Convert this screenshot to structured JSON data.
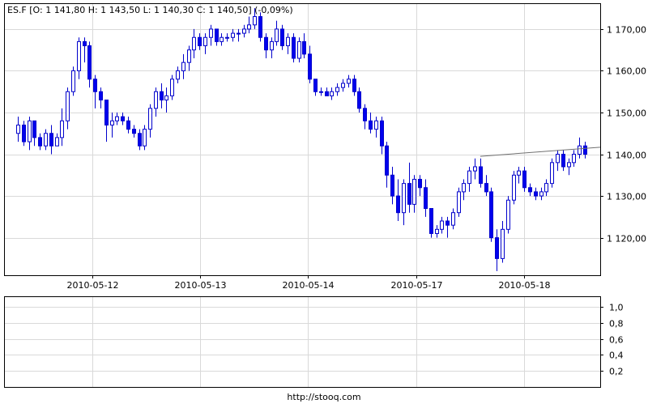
{
  "chart_data": [
    {
      "type": "candlestick",
      "title": "ES.F [O: 1 141,80  H: 1 143,50  L: 1 140,30  C: 1 140,50] (-0,09%)",
      "x_labels": [
        "2010-05-12",
        "2010-05-13",
        "2010-05-14",
        "2010-05-17",
        "2010-05-18"
      ],
      "y_tick_labels": [
        "1 120,00",
        "1 130,00",
        "1 140,00",
        "1 150,00",
        "1 160,00",
        "1 170,00"
      ],
      "y_ticks": [
        1120,
        1130,
        1140,
        1150,
        1160,
        1170
      ],
      "ylim": [
        1111,
        1176
      ],
      "grid": true,
      "colors": {
        "bullish": "#ffffff",
        "bearish": "#0000ee",
        "wick": "#0000cc",
        "grid": "#d9d9d9",
        "trendline": "#707070"
      },
      "trendline": {
        "start_index": 84,
        "start_value": 1139.5,
        "end_index": 107,
        "end_value": 1141.8
      },
      "candles": [
        [
          1145,
          1149,
          1143,
          1147
        ],
        [
          1147,
          1148,
          1142,
          1143
        ],
        [
          1143,
          1149,
          1141,
          1148
        ],
        [
          1148,
          1148,
          1142,
          1144
        ],
        [
          1144,
          1145,
          1141,
          1142
        ],
        [
          1142,
          1146,
          1141,
          1145
        ],
        [
          1145,
          1147,
          1140,
          1142
        ],
        [
          1142,
          1145,
          1142,
          1144
        ],
        [
          1144,
          1151,
          1142,
          1148
        ],
        [
          1148,
          1156,
          1146,
          1155
        ],
        [
          1155,
          1161,
          1154,
          1160
        ],
        [
          1160,
          1168,
          1158,
          1167
        ],
        [
          1167,
          1168,
          1162,
          1166
        ],
        [
          1166,
          1167,
          1156,
          1158
        ],
        [
          1158,
          1159,
          1151,
          1155
        ],
        [
          1155,
          1156,
          1151,
          1153
        ],
        [
          1153,
          1153,
          1143,
          1147
        ],
        [
          1147,
          1150,
          1144,
          1148
        ],
        [
          1148,
          1150,
          1147,
          1149
        ],
        [
          1149,
          1150,
          1147,
          1148
        ],
        [
          1148,
          1149,
          1145,
          1146
        ],
        [
          1146,
          1147,
          1144,
          1145
        ],
        [
          1145,
          1146,
          1141,
          1142
        ],
        [
          1142,
          1147,
          1141,
          1146
        ],
        [
          1146,
          1152,
          1144,
          1151
        ],
        [
          1151,
          1156,
          1149,
          1155
        ],
        [
          1155,
          1157,
          1151,
          1153
        ],
        [
          1153,
          1156,
          1150,
          1154
        ],
        [
          1154,
          1159,
          1153,
          1158
        ],
        [
          1158,
          1161,
          1157,
          1160
        ],
        [
          1160,
          1164,
          1158,
          1162
        ],
        [
          1162,
          1166,
          1160,
          1165
        ],
        [
          1165,
          1170,
          1163,
          1168
        ],
        [
          1168,
          1169,
          1165,
          1166
        ],
        [
          1166,
          1169,
          1164,
          1168
        ],
        [
          1168,
          1171,
          1166,
          1170
        ],
        [
          1170,
          1170,
          1166,
          1167
        ],
        [
          1167,
          1169,
          1166,
          1168
        ],
        [
          1168,
          1169,
          1167,
          1168
        ],
        [
          1168,
          1170,
          1167,
          1169
        ],
        [
          1169,
          1170,
          1167,
          1169
        ],
        [
          1169,
          1171,
          1168,
          1170
        ],
        [
          1170,
          1173,
          1169,
          1171
        ],
        [
          1171,
          1175,
          1170,
          1173
        ],
        [
          1173,
          1174,
          1167,
          1168
        ],
        [
          1168,
          1169,
          1163,
          1165
        ],
        [
          1165,
          1168,
          1163,
          1167
        ],
        [
          1167,
          1172,
          1166,
          1170
        ],
        [
          1170,
          1171,
          1165,
          1166
        ],
        [
          1166,
          1169,
          1164,
          1168
        ],
        [
          1168,
          1169,
          1162,
          1163
        ],
        [
          1163,
          1168,
          1162,
          1167
        ],
        [
          1167,
          1169,
          1163,
          1164
        ],
        [
          1164,
          1166,
          1157,
          1158
        ],
        [
          1158,
          1158,
          1154,
          1155
        ],
        [
          1155,
          1156,
          1154,
          1155
        ],
        [
          1155,
          1156,
          1154,
          1154
        ],
        [
          1154,
          1156,
          1153,
          1155
        ],
        [
          1155,
          1157,
          1154,
          1156
        ],
        [
          1156,
          1158,
          1155,
          1157
        ],
        [
          1157,
          1159,
          1156,
          1158
        ],
        [
          1158,
          1159,
          1154,
          1155
        ],
        [
          1155,
          1156,
          1150,
          1151
        ],
        [
          1151,
          1152,
          1146,
          1148
        ],
        [
          1148,
          1150,
          1145,
          1146
        ],
        [
          1146,
          1149,
          1144,
          1148
        ],
        [
          1148,
          1149,
          1140,
          1142
        ],
        [
          1142,
          1143,
          1132,
          1135
        ],
        [
          1135,
          1137,
          1128,
          1130
        ],
        [
          1130,
          1134,
          1124,
          1126
        ],
        [
          1126,
          1134,
          1123,
          1133
        ],
        [
          1133,
          1138,
          1126,
          1128
        ],
        [
          1128,
          1135,
          1126,
          1134
        ],
        [
          1134,
          1135,
          1130,
          1132
        ],
        [
          1132,
          1134,
          1125,
          1127
        ],
        [
          1127,
          1127,
          1120,
          1121
        ],
        [
          1121,
          1123,
          1120,
          1122
        ],
        [
          1122,
          1125,
          1121,
          1124
        ],
        [
          1124,
          1125,
          1120,
          1123
        ],
        [
          1123,
          1127,
          1122,
          1126
        ],
        [
          1126,
          1132,
          1125,
          1131
        ],
        [
          1131,
          1134,
          1129,
          1133
        ],
        [
          1133,
          1137,
          1131,
          1136
        ],
        [
          1136,
          1139,
          1134,
          1137
        ],
        [
          1137,
          1139,
          1132,
          1133
        ],
        [
          1133,
          1135,
          1130,
          1131
        ],
        [
          1131,
          1132,
          1119,
          1120
        ],
        [
          1120,
          1122,
          1112,
          1115
        ],
        [
          1115,
          1124,
          1114,
          1122
        ],
        [
          1122,
          1130,
          1121,
          1129
        ],
        [
          1129,
          1136,
          1128,
          1135
        ],
        [
          1135,
          1137,
          1133,
          1136
        ],
        [
          1136,
          1137,
          1131,
          1132
        ],
        [
          1132,
          1133,
          1130,
          1131
        ],
        [
          1131,
          1132,
          1129,
          1130
        ],
        [
          1130,
          1132,
          1129,
          1131
        ],
        [
          1131,
          1134,
          1130,
          1133
        ],
        [
          1133,
          1139,
          1132,
          1138
        ],
        [
          1138,
          1141,
          1136,
          1140
        ],
        [
          1140,
          1141,
          1136,
          1137
        ],
        [
          1137,
          1139,
          1135,
          1138
        ],
        [
          1138,
          1141,
          1137,
          1140
        ],
        [
          1140,
          1144,
          1139,
          1142
        ],
        [
          1142,
          1143,
          1139,
          1140
        ]
      ]
    },
    {
      "type": "line",
      "y_tick_labels": [
        "0,2",
        "0,4",
        "0,6",
        "0,8",
        "1,0"
      ],
      "y_ticks": [
        0.2,
        0.4,
        0.6,
        0.8,
        1.0
      ],
      "ylim": [
        0,
        1.12
      ],
      "grid": true,
      "series": []
    }
  ],
  "footer": {
    "text": "http://stooq.com"
  }
}
